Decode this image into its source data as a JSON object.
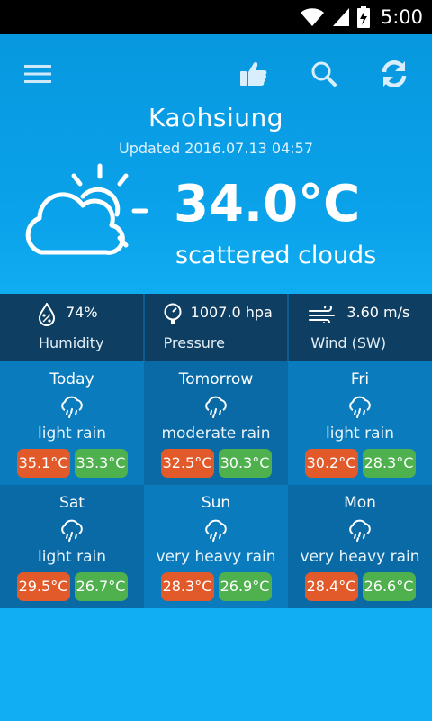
{
  "status_bar": {
    "time": "5:00",
    "icons": [
      "wifi-icon",
      "signal-icon",
      "battery-charging-icon"
    ]
  },
  "toolbar": {
    "icons": [
      "menu-icon",
      "thumbs-up-icon",
      "search-icon",
      "refresh-icon"
    ]
  },
  "current": {
    "city": "Kaohsiung",
    "updated": "Updated 2016.07.13 04:57",
    "temperature": "34.0°C",
    "condition": "scattered clouds",
    "icon": "partly-cloudy-sun-icon"
  },
  "stats": {
    "humidity": {
      "value": "74%",
      "label": "Humidity",
      "icon": "humidity-drop-icon"
    },
    "pressure": {
      "value": "1007.0 hpa",
      "label": "Pressure",
      "icon": "pressure-gauge-icon"
    },
    "wind": {
      "value": "3.60 m/s",
      "label": "Wind (SW)",
      "icon": "wind-icon"
    }
  },
  "forecast": [
    {
      "day": "Today",
      "desc": "light rain",
      "high": "35.1°C",
      "low": "33.3°C",
      "icon": "rain-cloud-icon"
    },
    {
      "day": "Tomorrow",
      "desc": "moderate rain",
      "high": "32.5°C",
      "low": "30.3°C",
      "icon": "rain-cloud-icon"
    },
    {
      "day": "Fri",
      "desc": "light rain",
      "high": "30.2°C",
      "low": "28.3°C",
      "icon": "rain-cloud-icon"
    },
    {
      "day": "Sat",
      "desc": "light rain",
      "high": "29.5°C",
      "low": "26.7°C",
      "icon": "rain-cloud-icon"
    },
    {
      "day": "Sun",
      "desc": "very heavy rain",
      "high": "28.3°C",
      "low": "26.9°C",
      "icon": "rain-cloud-icon"
    },
    {
      "day": "Mon",
      "desc": "very heavy rain",
      "high": "28.4°C",
      "low": "26.6°C",
      "icon": "rain-cloud-icon"
    }
  ],
  "colors": {
    "background": "#05a5f0",
    "stats_bar": "#0e3f63",
    "high_temp": "#e25a2a",
    "low_temp": "#4fb14d",
    "forecast_tile_a": "#0a7bbd",
    "forecast_tile_b": "#0a6aa6"
  }
}
